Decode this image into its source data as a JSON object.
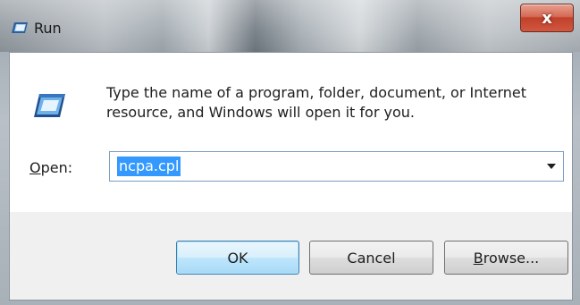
{
  "window": {
    "title": "Run",
    "close_label": "x"
  },
  "dialog": {
    "description_line1": "Type the name of a program, folder, document, or Internet",
    "description_line2": "resource, and Windows will open it for you.",
    "open_label": "Open:",
    "open_value": "ncpa.cpl"
  },
  "buttons": {
    "ok": "OK",
    "cancel": "Cancel",
    "browse": "Browse..."
  },
  "icons": {
    "title": "run-icon",
    "main": "run-icon",
    "dropdown": "chevron-down-icon"
  },
  "colors": {
    "selection": "#3399ff",
    "close_button": "#c2402a",
    "default_button_border": "#3c7fb1"
  }
}
